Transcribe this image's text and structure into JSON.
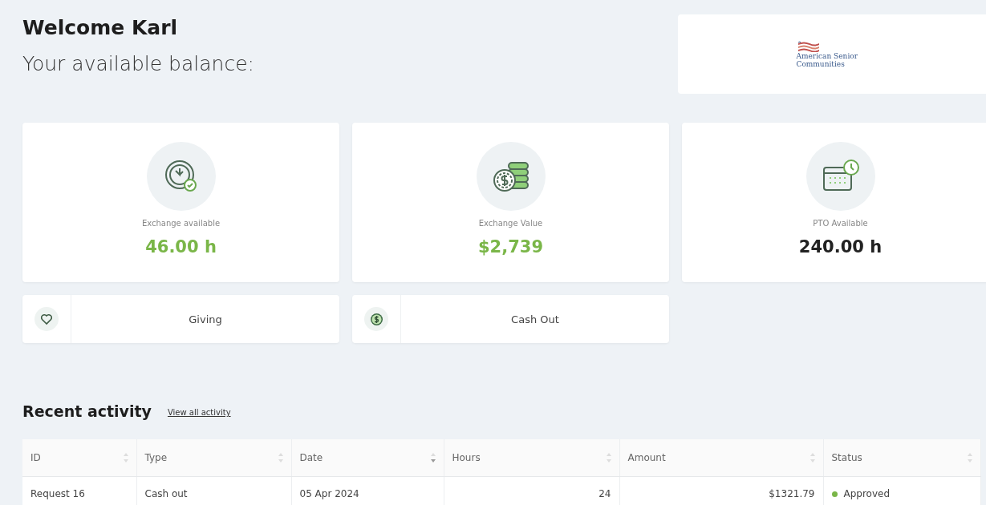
{
  "header": {
    "greeting": "Welcome Karl",
    "subtitle": "Your available balance:"
  },
  "logo": {
    "line_1": "American Senior",
    "line_2": "Communities"
  },
  "balances": [
    {
      "kind": "clock",
      "label": "Exchange available",
      "value": "46.00 h",
      "color": "#7ab648"
    },
    {
      "kind": "coins",
      "label": "Exchange Value",
      "value": "$2,739",
      "color": "#7ab648"
    },
    {
      "kind": "calendar",
      "label": "PTO Available",
      "value": "240.00 h",
      "color": "#222222"
    }
  ],
  "actions": [
    {
      "kind": "heart",
      "label": "Giving"
    },
    {
      "kind": "dollar",
      "label": "Cash Out"
    }
  ],
  "recent_activity": {
    "title": "Recent activity",
    "link": "View all activity",
    "columns": [
      {
        "label": "ID",
        "sorted": false,
        "numeric": false
      },
      {
        "label": "Type",
        "sorted": false,
        "numeric": false
      },
      {
        "label": "Date",
        "sorted": true,
        "numeric": false
      },
      {
        "label": "Hours",
        "sorted": false,
        "numeric": true
      },
      {
        "label": "Amount",
        "sorted": false,
        "numeric": true
      },
      {
        "label": "Status",
        "sorted": false,
        "numeric": false
      }
    ],
    "rows": [
      {
        "cells": [
          "Request 16",
          "Cash out",
          "05 Apr 2024",
          "24",
          "$1321.79"
        ],
        "status": {
          "label": "Approved",
          "color": "#7ab648"
        }
      }
    ]
  }
}
